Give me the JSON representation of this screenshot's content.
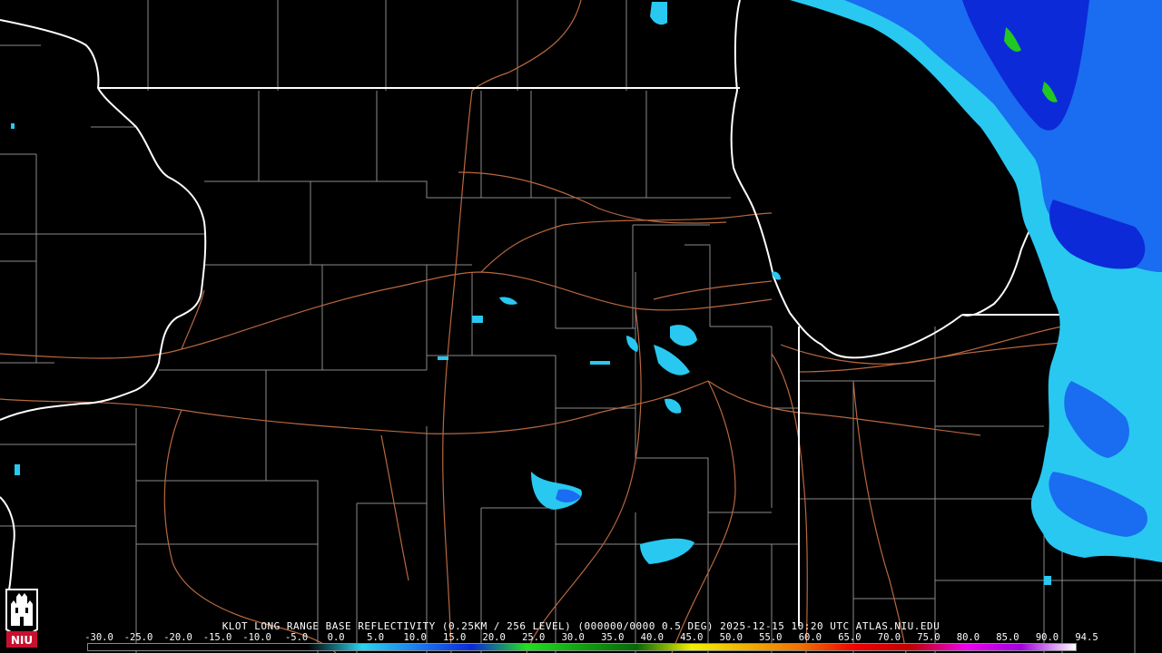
{
  "caption": "KLOT LONG RANGE BASE REFLECTIVITY (0.25KM / 256 LEVEL) (000000/0000 0.5 DEG) 2025-12-15 10:20 UTC  ATLAS.NIU.EDU",
  "scale_ticks": [
    "-30.0",
    "-25.0",
    "-20.0",
    "-15.0",
    "-10.0",
    "-5.0",
    "0.0",
    "5.0",
    "10.0",
    "15.0",
    "20.0",
    "25.0",
    "30.0",
    "35.0",
    "40.0",
    "45.0",
    "50.0",
    "55.0",
    "60.0",
    "65.0",
    "70.0",
    "75.0",
    "80.0",
    "85.0",
    "90.0",
    "94.5"
  ],
  "logo_text": "NIU",
  "colors": {
    "background": "#000000",
    "state_border": "#ffffff",
    "county_border": "#8a8a8a",
    "highway": "#b8683e",
    "echo_light": "#29c8f0",
    "echo_mid": "#1a6cf0",
    "echo_heavy": "#0c2ad8",
    "echo_green": "#22c822"
  },
  "scale_gradient": [
    "#000000",
    "#000000",
    "#000000",
    "#000000",
    "#000000",
    "#2bd3f0",
    "#1a7cf0",
    "#0c2ad8",
    "#22e022",
    "#10a010",
    "#086808",
    "#f0f000",
    "#f0b000",
    "#f07000",
    "#f00000",
    "#c00000",
    "#f000f0",
    "#a000e0",
    "#ffffff"
  ]
}
